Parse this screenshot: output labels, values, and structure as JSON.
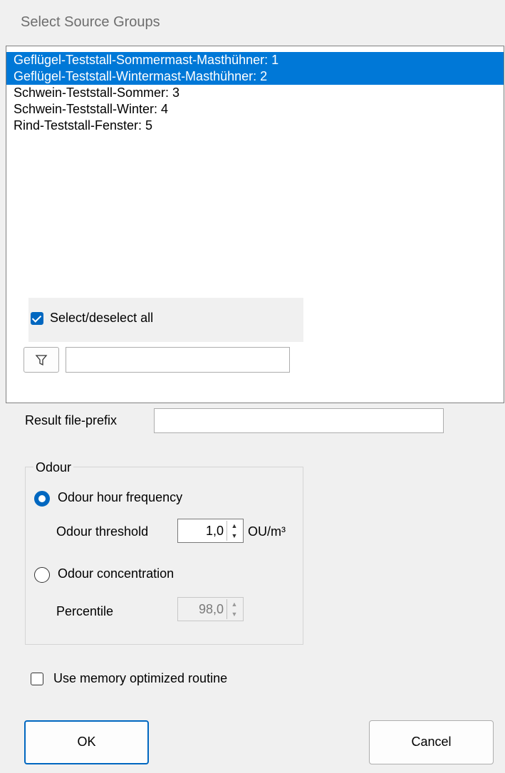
{
  "window": {
    "title": "Select Source Groups"
  },
  "source_groups": {
    "items": [
      {
        "label": "Geflügel-Teststall-Sommermast-Masthühner: 1",
        "selected": true
      },
      {
        "label": "Geflügel-Teststall-Wintermast-Masthühner: 2",
        "selected": true
      },
      {
        "label": "Schwein-Teststall-Sommer: 3",
        "selected": false
      },
      {
        "label": "Schwein-Teststall-Winter: 4",
        "selected": false
      },
      {
        "label": "Rind-Teststall-Fenster: 5",
        "selected": false
      }
    ],
    "select_all": {
      "label": "Select/deselect all",
      "checked": true
    },
    "filter": {
      "icon": "filter-icon",
      "value": ""
    }
  },
  "result_prefix": {
    "label": "Result file-prefix",
    "value": ""
  },
  "odour": {
    "group_label": "Odour",
    "hour_frequency": {
      "label": "Odour hour frequency",
      "selected": true
    },
    "threshold": {
      "label": "Odour threshold",
      "value": "1,0",
      "unit": "OU/m³"
    },
    "concentration": {
      "label": "Odour concentration",
      "selected": false
    },
    "percentile": {
      "label": "Percentile",
      "value": "98,0",
      "enabled": false
    }
  },
  "memory_optimized": {
    "label": "Use memory optimized routine",
    "checked": false
  },
  "buttons": {
    "ok": "OK",
    "cancel": "Cancel"
  },
  "colors": {
    "selection": "#0078d7",
    "accent": "#0067c0"
  }
}
